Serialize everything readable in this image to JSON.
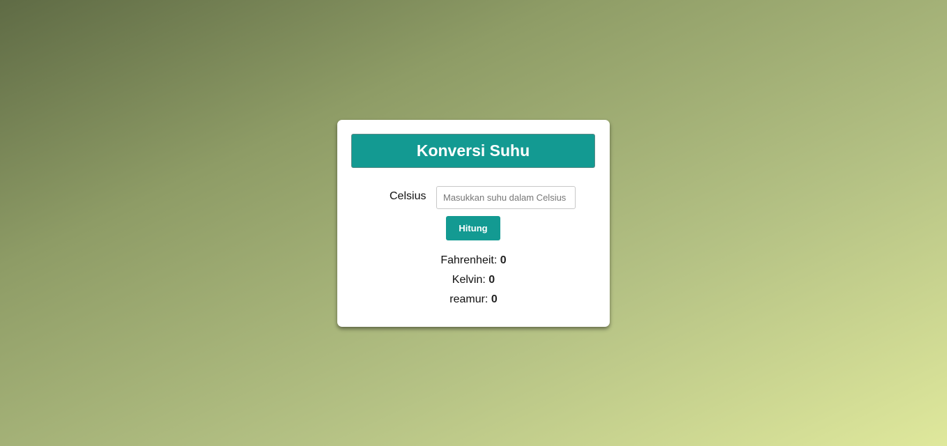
{
  "title": "Konversi Suhu",
  "input": {
    "label": "Celsius",
    "placeholder": "Masukkan suhu dalam Celsius",
    "value": ""
  },
  "button": "Hitung",
  "results": [
    {
      "label": "Fahrenheit:",
      "value": "0"
    },
    {
      "label": "Kelvin:",
      "value": "0"
    },
    {
      "label": "reamur:",
      "value": "0"
    }
  ]
}
